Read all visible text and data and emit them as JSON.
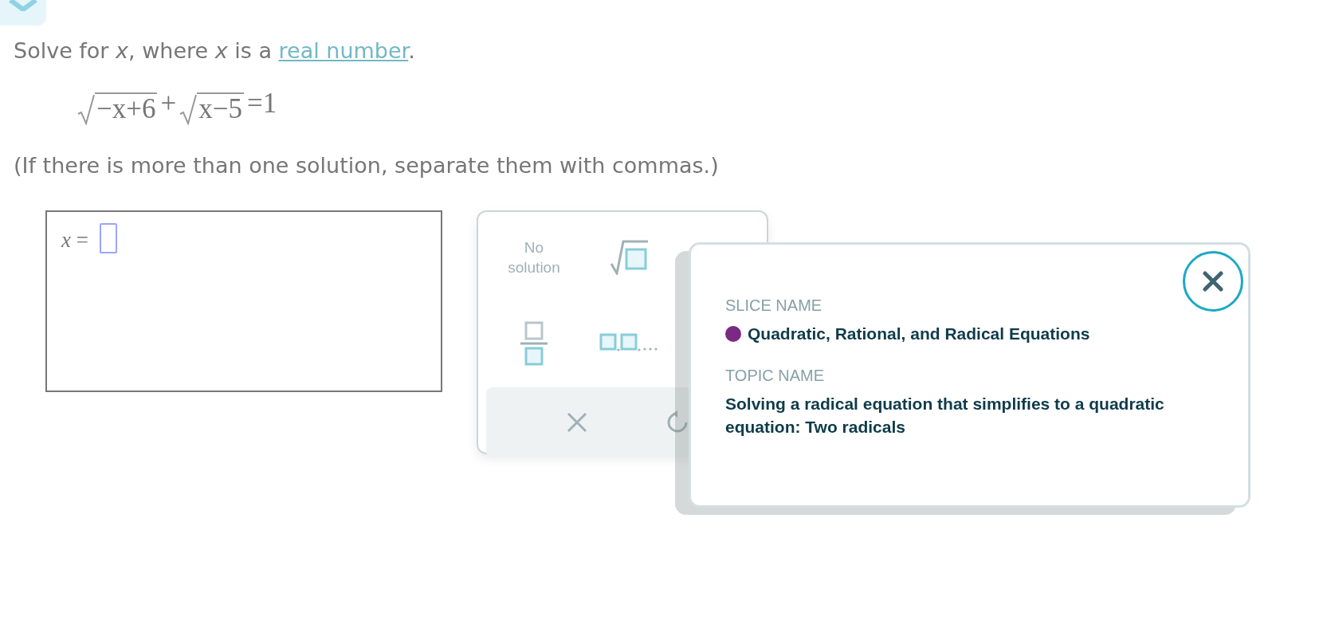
{
  "prompt": {
    "before": "Solve for *x*, where *x* is a ",
    "link": "real number",
    "after": "."
  },
  "equation": {
    "terms": [
      {
        "kind": "radical",
        "text": "−x+6"
      },
      {
        "kind": "plain",
        "text": "+"
      },
      {
        "kind": "radical",
        "text": "x−5"
      },
      {
        "kind": "plain",
        "text": "=1"
      }
    ]
  },
  "note": "(If there is more than one solution, separate them with commas.)",
  "answer": {
    "label": "*x* ="
  },
  "keypad": {
    "keys": [
      {
        "kind": "text",
        "label": "No solution"
      },
      {
        "kind": "sqrt"
      },
      {
        "kind": "fraction"
      },
      {
        "kind": "list"
      },
      {
        "kind": "clear"
      },
      {
        "kind": "undo"
      }
    ]
  },
  "popup": {
    "slice_label": "SLICE NAME",
    "slice": {
      "name": "Quadratic, Rational, and Radical Equations",
      "color": "#7b2a83"
    },
    "topic_label": "TOPIC NAME",
    "topic": "Solving a radical equation that simplifies to a quadratic equation: Two radicals"
  }
}
